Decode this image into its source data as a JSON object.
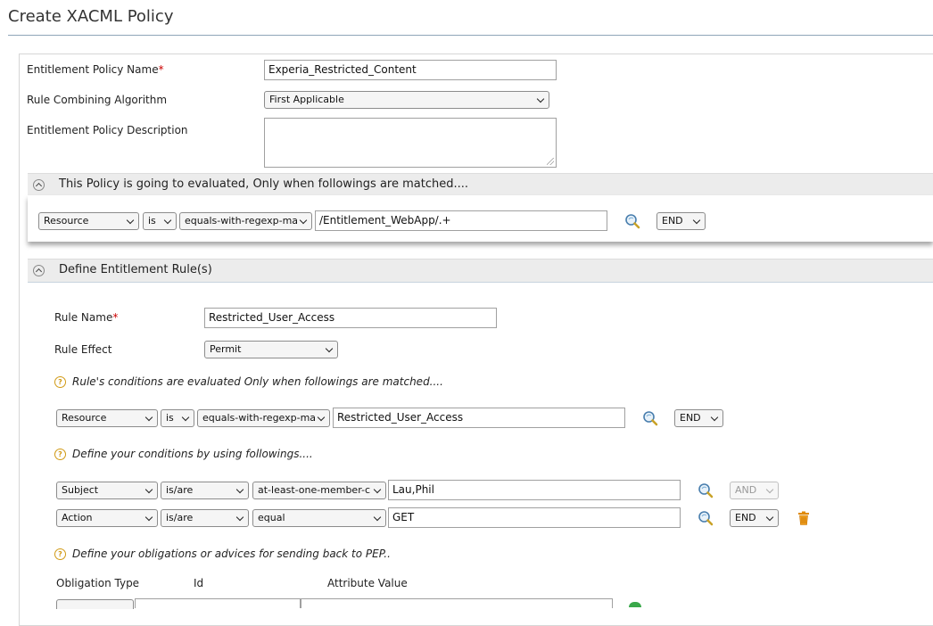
{
  "page": {
    "title": "Create XACML Policy"
  },
  "form": {
    "policy_name_label": "Entitlement Policy Name",
    "required_mark": "*",
    "policy_name_value": "Experia_Restricted_Content",
    "algorithm_label": "Rule Combining Algorithm",
    "algorithm_value": "First Applicable",
    "description_label": "Entitlement Policy Description",
    "description_value": ""
  },
  "target_section": {
    "title": "This Policy is going to evaluated, Only when followings are matched....",
    "row": {
      "category": "Resource",
      "operator": "is",
      "function": "equals-with-regexp-ma",
      "value": "/Entitlement_WebApp/.+",
      "combiner": "END"
    }
  },
  "rules_section": {
    "title": "Define Entitlement Rule(s)",
    "rule_name_label": "Rule Name",
    "rule_name_value": "Restricted_User_Access",
    "rule_effect_label": "Rule Effect",
    "rule_effect_value": "Permit",
    "rule_target_hint": "Rule's conditions are evaluated Only when followings are matched....",
    "rule_target_row": {
      "category": "Resource",
      "operator": "is",
      "function": "equals-with-regexp-ma",
      "value": "Restricted_User_Access",
      "combiner": "END"
    },
    "conditions_hint": "Define your conditions by using followings....",
    "conditions": [
      {
        "category": "Subject",
        "operator": "is/are",
        "function": "at-least-one-member-c",
        "value": "Lau,Phil",
        "combiner": "AND"
      },
      {
        "category": "Action",
        "operator": "is/are",
        "function": "equal",
        "value": "GET",
        "combiner": "END"
      }
    ],
    "obligations_hint": "Define your obligations or advices for sending back to PEP..",
    "obligation_headers": {
      "type": "Obligation Type",
      "id": "Id",
      "attr": "Attribute Value"
    }
  },
  "icons": {
    "search": "search-magnifier-icon",
    "delete": "trash-icon",
    "help": "help-icon",
    "collapse": "chevron-up-icon",
    "add": "add-icon"
  },
  "colors": {
    "required": "#cc0000",
    "help": "#d19a16",
    "delete": "#e08a00",
    "rule_line": "#8fa6b8"
  }
}
